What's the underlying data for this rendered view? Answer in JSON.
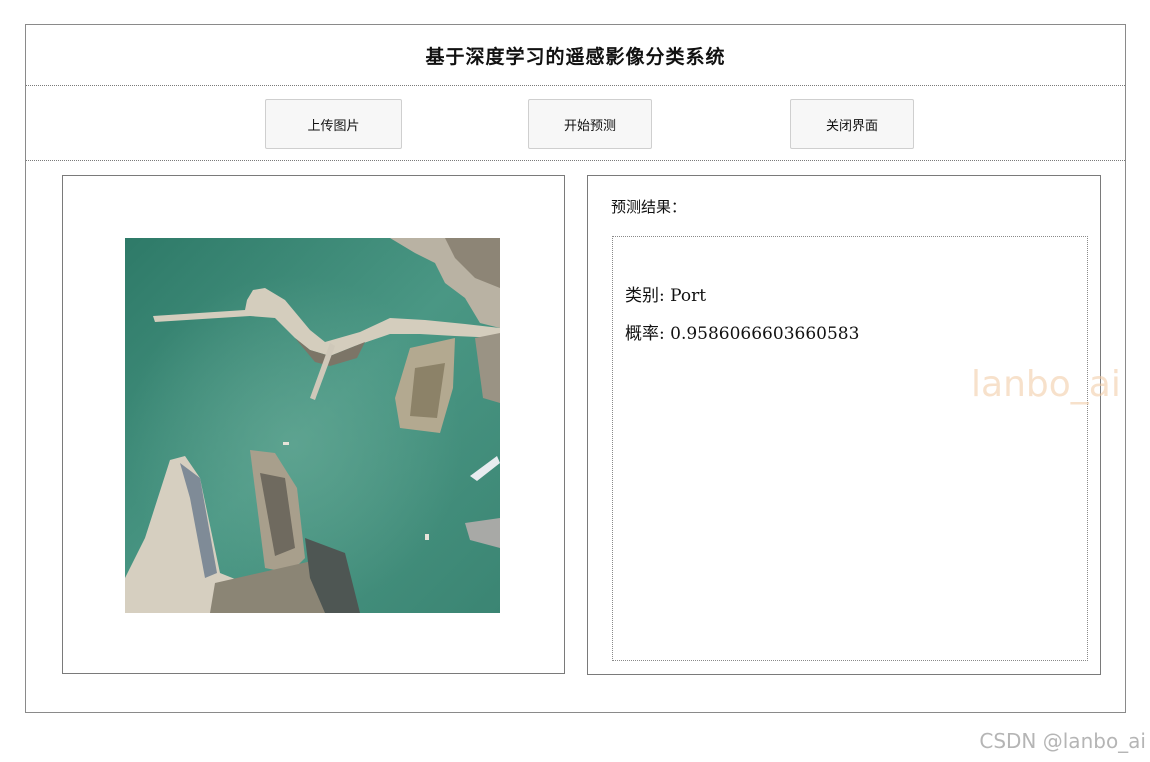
{
  "window": {
    "title": "基于深度学习的遥感影像分类系统"
  },
  "toolbar": {
    "upload_label": "上传图片",
    "predict_label": "开始预测",
    "close_label": "关闭界面"
  },
  "image_panel": {
    "image_description": "aerial-harbor-photo"
  },
  "result_panel": {
    "heading": "预测结果：",
    "class_line": "类别: Port",
    "probability_line": "概率: 0.9586066603660583"
  },
  "watermarks": {
    "inner": "lanbo_ai",
    "corner": "CSDN @lanbo_ai"
  },
  "colors": {
    "water": "#3f8a78",
    "pier": "#d8d2c4",
    "watermark_inner": "#f0c8a0",
    "watermark_corner": "#b5b5b5"
  }
}
